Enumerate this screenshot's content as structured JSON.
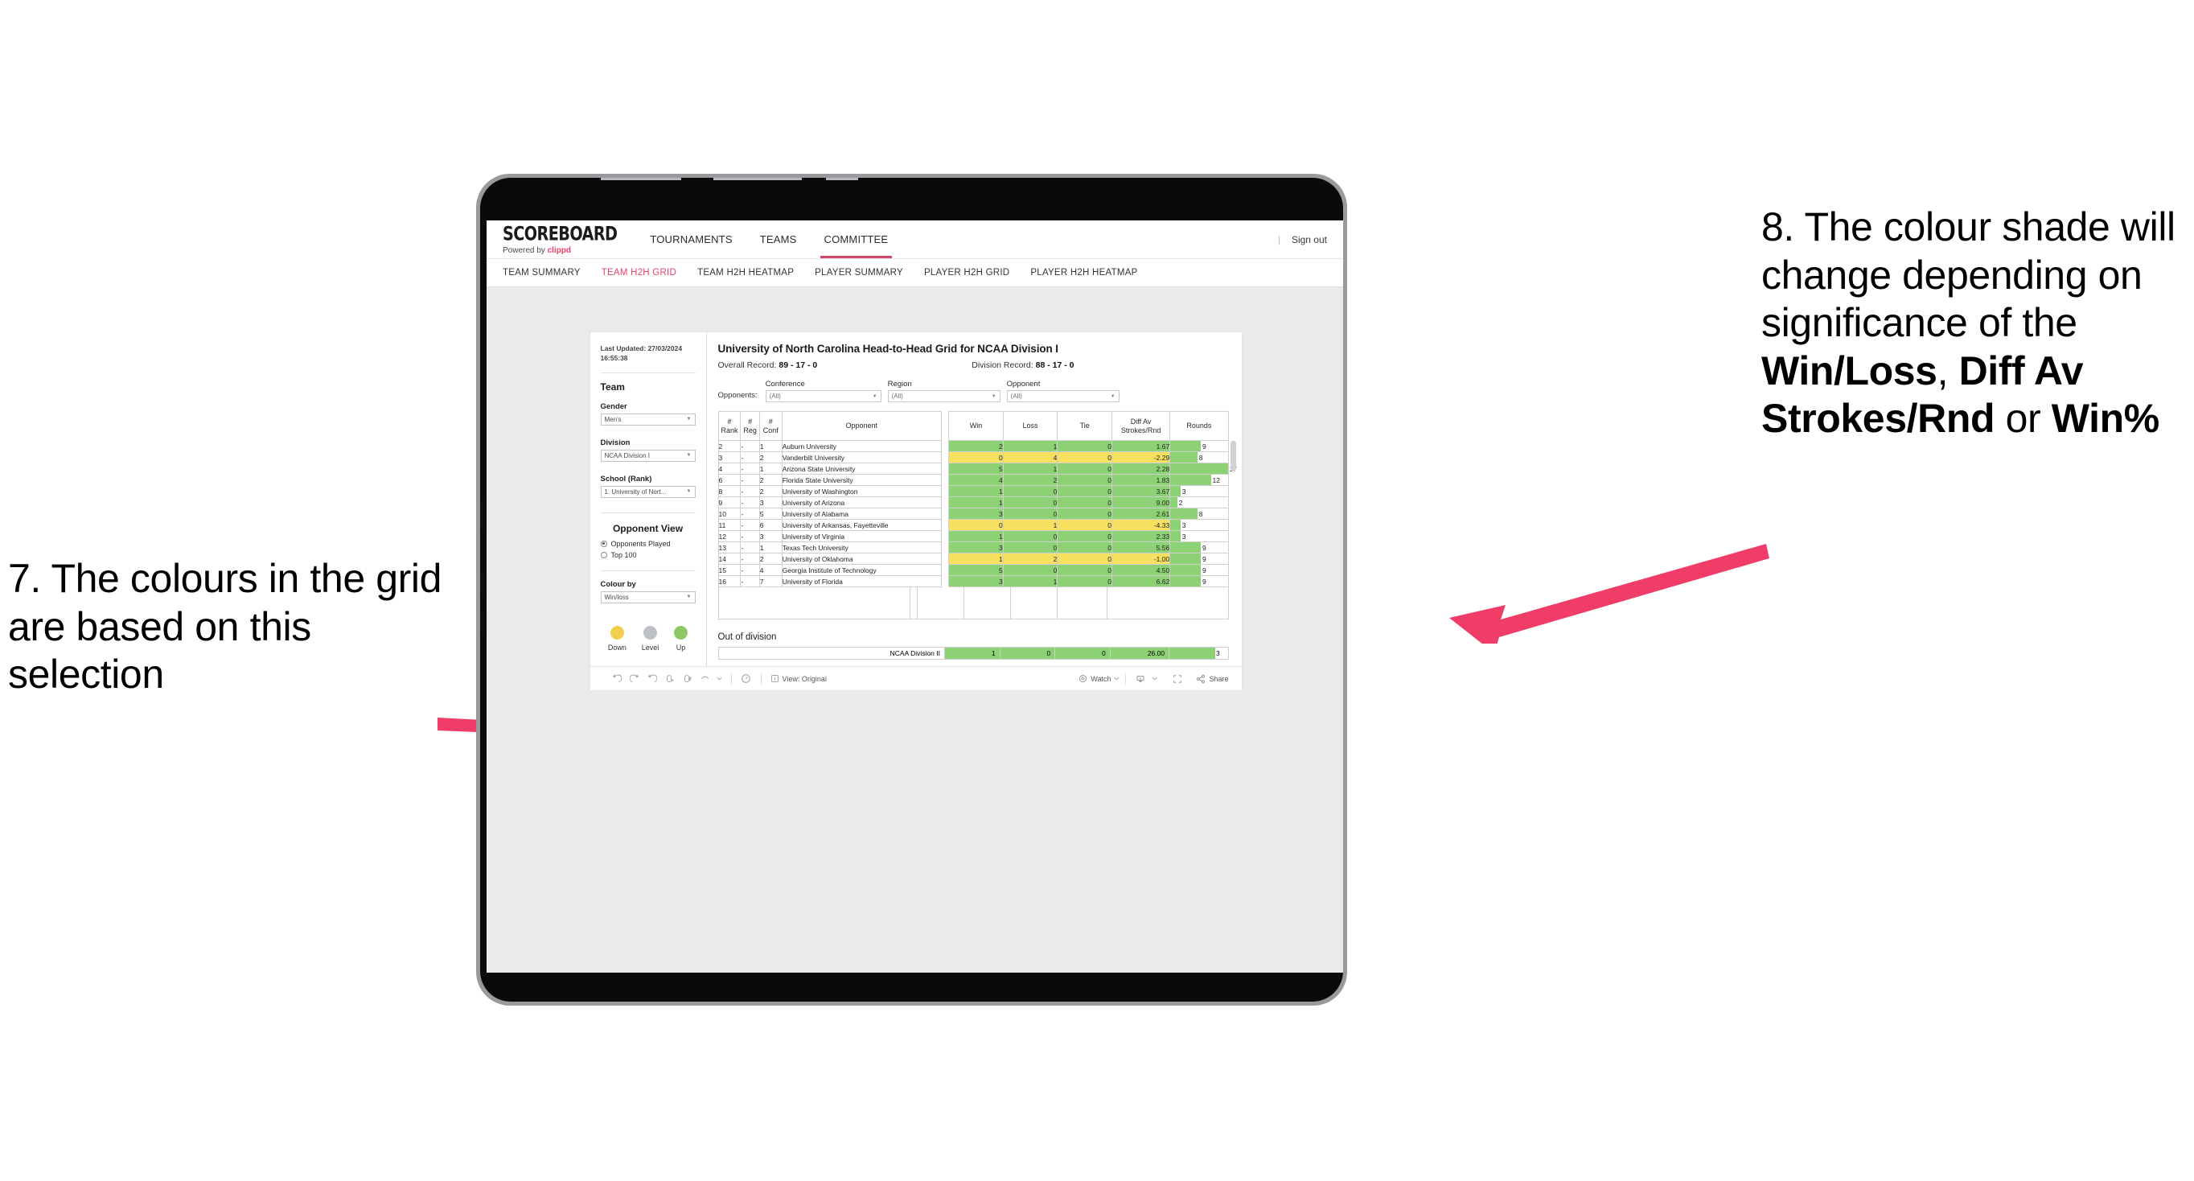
{
  "annotations": {
    "left": {
      "id": "7",
      "text": "7. The colours in the grid are based on this selection"
    },
    "right": {
      "id": "8",
      "line1": "8. The colour shade will change depending on significance of the ",
      "bold1": "Win/Loss",
      "mid1": ", ",
      "bold2": "Diff Av Strokes/Rnd",
      "mid2": " or ",
      "bold3": "Win%"
    },
    "arrow_color": "#ef3d68"
  },
  "header": {
    "logo_main": "SCOREBOARD",
    "logo_sub_prefix": "Powered by ",
    "logo_sub_brand": "clippd",
    "nav": [
      {
        "label": "TOURNAMENTS",
        "active": false
      },
      {
        "label": "TEAMS",
        "active": false
      },
      {
        "label": "COMMITTEE",
        "active": true
      }
    ],
    "divider": "|",
    "sign_out": "Sign out",
    "accent": "#d8456b"
  },
  "subnav": {
    "items": [
      {
        "label": "TEAM SUMMARY",
        "active": false
      },
      {
        "label": "TEAM H2H GRID",
        "active": true
      },
      {
        "label": "TEAM H2H HEATMAP",
        "active": false
      },
      {
        "label": "PLAYER SUMMARY",
        "active": false
      },
      {
        "label": "PLAYER H2H GRID",
        "active": false
      },
      {
        "label": "PLAYER H2H HEATMAP",
        "active": false
      }
    ],
    "active_color": "#e8436d"
  },
  "sidebar": {
    "last_updated_label": "Last Updated:",
    "last_updated_value": "27/03/2024 16:55:38",
    "team_heading": "Team",
    "gender_label": "Gender",
    "gender_value": "Men's",
    "division_label": "Division",
    "division_value": "NCAA Division I",
    "school_label": "School (Rank)",
    "school_value": "1. University of Nort...",
    "opponent_view_heading": "Opponent View",
    "radio_opponents_played": "Opponents Played",
    "radio_top_100": "Top 100",
    "colour_by_label": "Colour by",
    "colour_by_value": "Win/loss",
    "legend": [
      {
        "caption": "Down",
        "color": "#f2d04e"
      },
      {
        "caption": "Level",
        "color": "#bdc0c4"
      },
      {
        "caption": "Up",
        "color": "#8dc863"
      }
    ]
  },
  "viz": {
    "title": "University of North Carolina Head-to-Head Grid for NCAA Division I",
    "overall_record_label": "Overall Record:",
    "overall_record_value": "89 - 17 - 0",
    "division_record_label": "Division Record:",
    "division_record_value": "88 - 17 - 0",
    "opponents_label": "Opponents:",
    "filters": [
      {
        "label": "Conference",
        "value": "(All)"
      },
      {
        "label": "Region",
        "value": "(All)"
      },
      {
        "label": "Opponent",
        "value": "(All)"
      }
    ],
    "columns": {
      "rank": "#\nRank",
      "rank_l1": "#",
      "rank_l2": "Rank",
      "reg_l1": "#",
      "reg_l2": "Reg",
      "conf_l1": "#",
      "conf_l2": "Conf",
      "opponent": "Opponent",
      "win": "Win",
      "loss": "Loss",
      "tie": "Tie",
      "diff_l1": "Diff Av",
      "diff_l2": "Strokes/Rnd",
      "rounds": "Rounds"
    },
    "out_of_division_title": "Out of division",
    "out_of_division_row": {
      "name": "NCAA Division II",
      "win": "1",
      "loss": "0",
      "tie": "0",
      "diff": "26.00",
      "rounds": "3",
      "state": "up"
    },
    "colors": {
      "up": "#8dd175",
      "down": "#f7e05f",
      "rounds_bar": "#8dd175"
    }
  },
  "chart_data": {
    "type": "table",
    "title": "University of North Carolina Head-to-Head Grid for NCAA Division I",
    "columns": [
      "# Rank",
      "# Reg",
      "# Conf",
      "Opponent",
      "Win",
      "Loss",
      "Tie",
      "Diff Av Strokes/Rnd",
      "Rounds"
    ],
    "rounds_max": 17,
    "rows": [
      {
        "rank": "2",
        "reg": "-",
        "conf": "1",
        "opponent": "Auburn University",
        "win": "2",
        "loss": "1",
        "tie": "0",
        "diff": "1.67",
        "rounds": "9",
        "rounds_n": 9,
        "state": "up"
      },
      {
        "rank": "3",
        "reg": "-",
        "conf": "2",
        "opponent": "Vanderbilt University",
        "win": "0",
        "loss": "4",
        "tie": "0",
        "diff": "-2.29",
        "rounds": "8",
        "rounds_n": 8,
        "state": "down"
      },
      {
        "rank": "4",
        "reg": "-",
        "conf": "1",
        "opponent": "Arizona State University",
        "win": "5",
        "loss": "1",
        "tie": "0",
        "diff": "2.28",
        "rounds": "17",
        "rounds_n": 17,
        "state": "up"
      },
      {
        "rank": "6",
        "reg": "-",
        "conf": "2",
        "opponent": "Florida State University",
        "win": "4",
        "loss": "2",
        "tie": "0",
        "diff": "1.83",
        "rounds": "12",
        "rounds_n": 12,
        "state": "up"
      },
      {
        "rank": "8",
        "reg": "-",
        "conf": "2",
        "opponent": "University of Washington",
        "win": "1",
        "loss": "0",
        "tie": "0",
        "diff": "3.67",
        "rounds": "3",
        "rounds_n": 3,
        "state": "up"
      },
      {
        "rank": "9",
        "reg": "-",
        "conf": "3",
        "opponent": "University of Arizona",
        "win": "1",
        "loss": "0",
        "tie": "0",
        "diff": "9.00",
        "rounds": "2",
        "rounds_n": 2,
        "state": "up"
      },
      {
        "rank": "10",
        "reg": "-",
        "conf": "5",
        "opponent": "University of Alabama",
        "win": "3",
        "loss": "0",
        "tie": "0",
        "diff": "2.61",
        "rounds": "8",
        "rounds_n": 8,
        "state": "up"
      },
      {
        "rank": "11",
        "reg": "-",
        "conf": "6",
        "opponent": "University of Arkansas, Fayetteville",
        "win": "0",
        "loss": "1",
        "tie": "0",
        "diff": "-4.33",
        "rounds": "3",
        "rounds_n": 3,
        "state": "down"
      },
      {
        "rank": "12",
        "reg": "-",
        "conf": "3",
        "opponent": "University of Virginia",
        "win": "1",
        "loss": "0",
        "tie": "0",
        "diff": "2.33",
        "rounds": "3",
        "rounds_n": 3,
        "state": "up"
      },
      {
        "rank": "13",
        "reg": "-",
        "conf": "1",
        "opponent": "Texas Tech University",
        "win": "3",
        "loss": "0",
        "tie": "0",
        "diff": "5.56",
        "rounds": "9",
        "rounds_n": 9,
        "state": "up"
      },
      {
        "rank": "14",
        "reg": "-",
        "conf": "2",
        "opponent": "University of Oklahoma",
        "win": "1",
        "loss": "2",
        "tie": "0",
        "diff": "-1.00",
        "rounds": "9",
        "rounds_n": 9,
        "state": "down"
      },
      {
        "rank": "15",
        "reg": "-",
        "conf": "4",
        "opponent": "Georgia Institute of Technology",
        "win": "5",
        "loss": "0",
        "tie": "0",
        "diff": "4.50",
        "rounds": "9",
        "rounds_n": 9,
        "state": "up"
      },
      {
        "rank": "16",
        "reg": "-",
        "conf": "7",
        "opponent": "University of Florida",
        "win": "3",
        "loss": "1",
        "tie": "0",
        "diff": "6.62",
        "rounds": "9",
        "rounds_n": 9,
        "state": "up"
      }
    ]
  },
  "toolbar": {
    "view_label": "View: Original",
    "watch_label": "Watch",
    "share_label": "Share"
  }
}
